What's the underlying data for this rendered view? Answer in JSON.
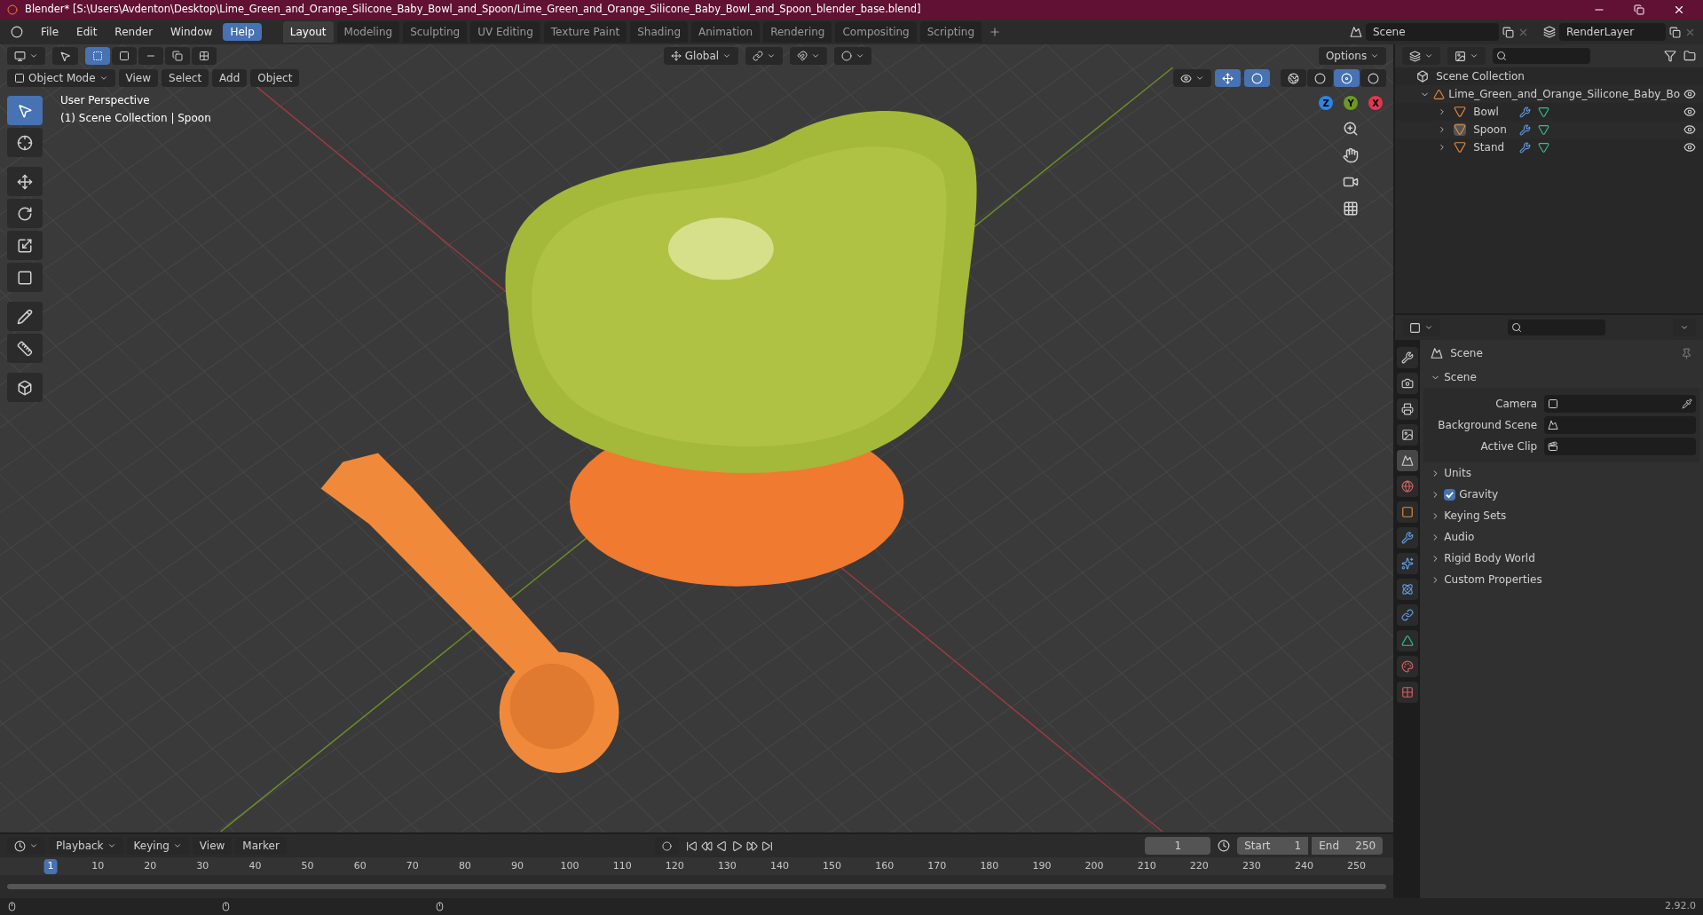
{
  "window": {
    "title": "Blender* [S:\\Users\\Avdenton\\Desktop\\Lime_Green_and_Orange_Silicone_Baby_Bowl_and_Spoon/Lime_Green_and_Orange_Silicone_Baby_Bowl_and_Spoon_blender_base.blend]"
  },
  "menus": [
    {
      "label": "File",
      "selected": false
    },
    {
      "label": "Edit",
      "selected": false
    },
    {
      "label": "Render",
      "selected": false
    },
    {
      "label": "Window",
      "selected": false
    },
    {
      "label": "Help",
      "selected": true
    }
  ],
  "workspaces": [
    {
      "label": "Layout",
      "selected": true
    },
    {
      "label": "Modeling",
      "selected": false
    },
    {
      "label": "Sculpting",
      "selected": false
    },
    {
      "label": "UV Editing",
      "selected": false
    },
    {
      "label": "Texture Paint",
      "selected": false
    },
    {
      "label": "Shading",
      "selected": false
    },
    {
      "label": "Animation",
      "selected": false
    },
    {
      "label": "Rendering",
      "selected": false
    },
    {
      "label": "Compositing",
      "selected": false
    },
    {
      "label": "Scripting",
      "selected": false
    }
  ],
  "scene": "Scene",
  "view_layer": "RenderLayer",
  "tool_header": {
    "orientation": "Global",
    "options": "Options",
    "selection_modes": [
      {
        "kind": "set",
        "selected": true
      },
      {
        "kind": "extend",
        "selected": false
      },
      {
        "kind": "subtract",
        "selected": false
      },
      {
        "kind": "invert",
        "selected": false
      },
      {
        "kind": "intersect",
        "selected": false
      }
    ]
  },
  "viewport_header": {
    "mode": "Object Mode",
    "menus": [
      "View",
      "Select",
      "Add",
      "Object"
    ],
    "gizmos_on": true,
    "overlays_on": true,
    "shading": [
      {
        "kind": "wireframe",
        "selected": false
      },
      {
        "kind": "solid",
        "selected": false
      },
      {
        "kind": "material",
        "selected": true
      },
      {
        "kind": "rendered",
        "selected": false
      }
    ]
  },
  "viewport": {
    "info": [
      "User Perspective",
      "(1) Scene Collection | Spoon"
    ],
    "gizmo": [
      "Z",
      "Y",
      "X"
    ]
  },
  "tools": [
    {
      "kind": "select",
      "selected": true
    },
    {
      "kind": "cursor",
      "selected": false
    },
    {
      "kind": "move",
      "selected": false
    },
    {
      "kind": "rotate",
      "selected": false
    },
    {
      "kind": "scale",
      "selected": false
    },
    {
      "kind": "transform",
      "selected": false
    },
    {
      "kind": "annotate",
      "selected": false
    },
    {
      "kind": "measure",
      "selected": false
    },
    {
      "kind": "add",
      "selected": false
    }
  ],
  "outliner": {
    "root": "Scene Collection",
    "collection": {
      "label": "Lime_Green_and_Orange_Silicone_Baby_Bo",
      "expanded": true,
      "children": [
        {
          "label": "Bowl",
          "expanded": false,
          "selected": false
        },
        {
          "label": "Spoon",
          "expanded": false,
          "selected": true
        },
        {
          "label": "Stand",
          "expanded": false,
          "selected": false
        }
      ]
    }
  },
  "properties": {
    "tabs": [
      {
        "kind": "tool",
        "selected": false
      },
      {
        "kind": "render",
        "selected": false
      },
      {
        "kind": "output",
        "selected": false
      },
      {
        "kind": "view_layer",
        "selected": false
      },
      {
        "kind": "scene",
        "selected": true
      },
      {
        "kind": "world",
        "selected": false
      },
      {
        "kind": "object",
        "selected": false
      },
      {
        "kind": "modifier",
        "selected": false
      },
      {
        "kind": "particles",
        "selected": false
      },
      {
        "kind": "physics",
        "selected": false
      },
      {
        "kind": "constraints",
        "selected": false
      },
      {
        "kind": "data",
        "selected": false
      },
      {
        "kind": "material",
        "selected": false
      },
      {
        "kind": "texture",
        "selected": false
      }
    ],
    "context": "Scene",
    "panels": [
      {
        "kind": "panel",
        "label": "Scene",
        "expanded": true,
        "fields": [
          {
            "label": "Camera",
            "kind": "camera"
          },
          {
            "label": "Background Scene",
            "kind": "scene"
          },
          {
            "label": "Active Clip",
            "kind": "clip"
          }
        ]
      },
      {
        "kind": "panel",
        "label": "Units",
        "expanded": false
      },
      {
        "kind": "checkbox",
        "label": "Gravity",
        "expanded": false,
        "checked": true
      },
      {
        "kind": "panel",
        "label": "Keying Sets",
        "expanded": false
      },
      {
        "kind": "panel",
        "label": "Audio",
        "expanded": false
      },
      {
        "kind": "panel",
        "label": "Rigid Body World",
        "expanded": false
      },
      {
        "kind": "panel",
        "label": "Custom Properties",
        "expanded": false
      }
    ]
  },
  "timeline": {
    "menus": [
      "Playback",
      "Keying",
      "View",
      "Marker"
    ],
    "current_frame": "1",
    "start_label": "Start",
    "start": "1",
    "end_label": "End",
    "end": "250",
    "ruler": [
      {
        "label": "1",
        "selected": true
      },
      {
        "label": "10",
        "selected": false
      },
      {
        "label": "20",
        "selected": false
      },
      {
        "label": "30",
        "selected": false
      },
      {
        "label": "40",
        "selected": false
      },
      {
        "label": "50",
        "selected": false
      },
      {
        "label": "60",
        "selected": false
      },
      {
        "label": "70",
        "selected": false
      },
      {
        "label": "80",
        "selected": false
      },
      {
        "label": "90",
        "selected": false
      },
      {
        "label": "100",
        "selected": false
      },
      {
        "label": "110",
        "selected": false
      },
      {
        "label": "120",
        "selected": false
      },
      {
        "label": "130",
        "selected": false
      },
      {
        "label": "140",
        "selected": false
      },
      {
        "label": "150",
        "selected": false
      },
      {
        "label": "160",
        "selected": false
      },
      {
        "label": "170",
        "selected": false
      },
      {
        "label": "180",
        "selected": false
      },
      {
        "label": "190",
        "selected": false
      },
      {
        "label": "200",
        "selected": false
      },
      {
        "label": "210",
        "selected": false
      },
      {
        "label": "220",
        "selected": false
      },
      {
        "label": "230",
        "selected": false
      },
      {
        "label": "240",
        "selected": false
      },
      {
        "label": "250",
        "selected": false
      }
    ]
  },
  "status_bar": {
    "version": "2.92.0"
  }
}
